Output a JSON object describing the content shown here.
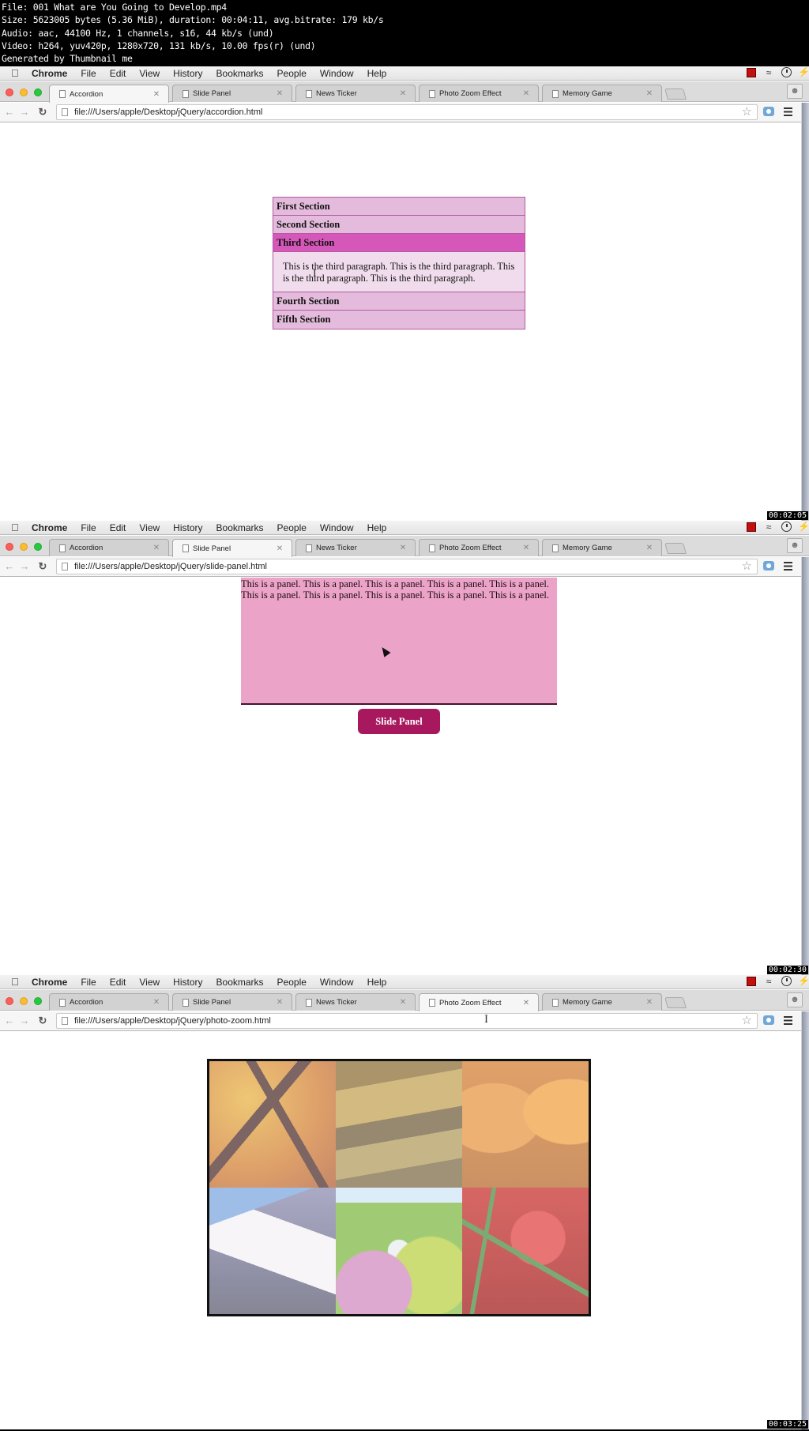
{
  "video_info": {
    "lines": [
      "File: 001 What are You Going to Develop.mp4",
      "Size: 5623005 bytes (5.36 MiB), duration: 00:04:11, avg.bitrate: 179 kb/s",
      "Audio: aac, 44100 Hz, 1 channels, s16, 44 kb/s (und)",
      "Video: h264, yuv420p, 1280x720, 131 kb/s, 10.00 fps(r) (und)",
      "Generated by Thumbnail me"
    ]
  },
  "menubar": {
    "app": "Chrome",
    "items": [
      "File",
      "Edit",
      "View",
      "History",
      "Bookmarks",
      "People",
      "Window",
      "Help"
    ]
  },
  "tabs": [
    {
      "label": "Accordion"
    },
    {
      "label": "Slide Panel"
    },
    {
      "label": "News Ticker"
    },
    {
      "label": "Photo Zoom Effect"
    },
    {
      "label": "Memory Game"
    }
  ],
  "frames": [
    {
      "url": "file:///Users/apple/Desktop/jQuery/accordion.html",
      "active_tab": 0,
      "timestamp": "00:02:05",
      "accordion": {
        "sections": [
          {
            "title": "First Section",
            "open": false
          },
          {
            "title": "Second Section",
            "open": false
          },
          {
            "title": "Third Section",
            "open": true,
            "content": "This is the third paragraph. This is the third paragraph. This is the third paragraph. This is the third paragraph."
          },
          {
            "title": "Fourth Section",
            "open": false
          },
          {
            "title": "Fifth Section",
            "open": false
          }
        ]
      }
    },
    {
      "url": "file:///Users/apple/Desktop/jQuery/slide-panel.html",
      "active_tab": 1,
      "timestamp": "00:02:30",
      "panel_text": "This is a panel. This is a panel. This is a panel. This is a panel. This is a panel. This is a panel. This is a panel. This is a panel. This is a panel. This is a panel.",
      "button_label": "Slide Panel"
    },
    {
      "url": "file:///Users/apple/Desktop/jQuery/photo-zoom.html",
      "active_tab": 3,
      "timestamp": "00:03:25",
      "photos": [
        {
          "subject": "autumn-tree"
        },
        {
          "subject": "dry-grass"
        },
        {
          "subject": "pumpkins"
        },
        {
          "subject": "snowy-mountain"
        },
        {
          "subject": "flowering-trees"
        },
        {
          "subject": "red-peppers"
        }
      ]
    }
  ],
  "colors": {
    "accordion_header": "#e4bbdc",
    "accordion_open_header": "#d657ba",
    "accordion_panel": "#f0dced",
    "slide_panel_bg": "#eba3c7",
    "slide_button": "#a8185e"
  }
}
